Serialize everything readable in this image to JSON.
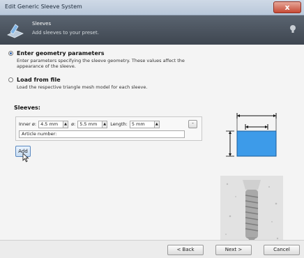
{
  "window": {
    "title": "Edit Generic Sleeve System",
    "close_label": "x"
  },
  "header": {
    "title": "Sleeves",
    "subtitle": "Add sleeves to your preset."
  },
  "options": [
    {
      "label": "Enter geometry parameters",
      "description": "Enter parameters specifying the sleeve geometry. These values affect the appearance of the sleeve.",
      "selected": true
    },
    {
      "label": "Load from file",
      "description": "Load the respective triangle mesh model for each sleeve.",
      "selected": false
    }
  ],
  "sleeves": {
    "label": "Sleeves:",
    "inner_label": "Inner ø:",
    "inner_value": "4.5 mm",
    "outer_label": "ø:",
    "outer_value": "5.5 mm",
    "length_label": "Length:",
    "length_value": "5 mm",
    "article_label": "Article number:",
    "remove_label": "-"
  },
  "add_button": "Add",
  "footer": {
    "back": "< Back",
    "next": "Next >",
    "cancel": "Cancel"
  },
  "colors": {
    "sleeve_fill": "#3d9be9",
    "header_bg": "#4a525c",
    "close_red": "#c74a35"
  }
}
